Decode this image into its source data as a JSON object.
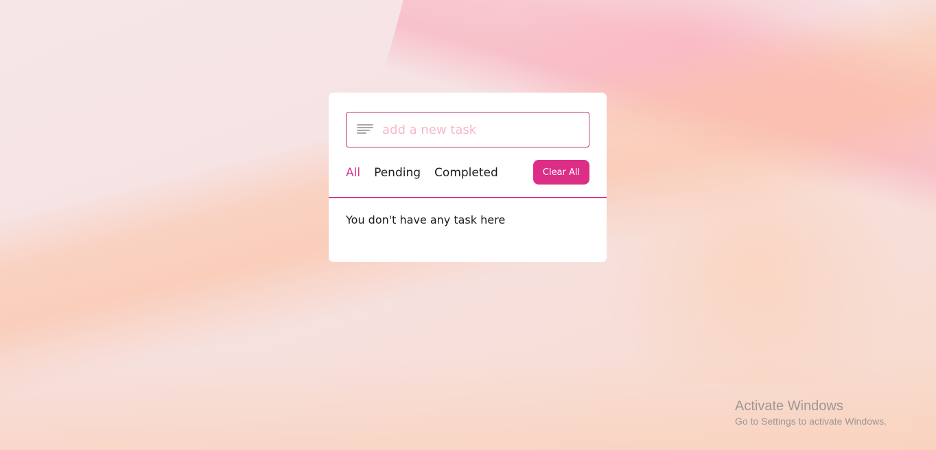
{
  "todo": {
    "input": {
      "placeholder": "add a new task",
      "value": ""
    },
    "filters": [
      {
        "label": "All",
        "active": true
      },
      {
        "label": "Pending",
        "active": false
      },
      {
        "label": "Completed",
        "active": false
      }
    ],
    "clear_label": "Clear All",
    "empty_message": "You don't have any task here",
    "icons": {
      "input_icon": "menu-lines-icon"
    },
    "colors": {
      "accent": "#dc2e87",
      "active_filter": "#d63a86",
      "placeholder": "#f7b8c6"
    }
  },
  "watermark": {
    "title": "Activate Windows",
    "subtitle": "Go to Settings to activate Windows."
  }
}
